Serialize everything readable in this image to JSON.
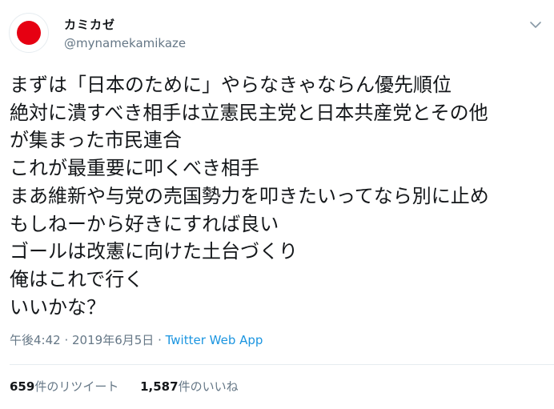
{
  "author": {
    "display_name": "カミカゼ",
    "handle": "@mynamekamikaze",
    "avatar_color": "#e60012"
  },
  "tweet": {
    "lines": [
      "まずは「日本のために」やらなきゃならん優先順位",
      "絶対に潰すべき相手は立憲民主党と日本共産党とその他",
      "が集まった市民連合",
      "これが最重要に叩くべき相手",
      "まあ維新や与党の売国勢力を叩きたいってなら別に止め",
      "もしねーから好きにすれば良い",
      "ゴールは改憲に向けた土台づくり",
      "俺はこれで行く",
      "いいかな？"
    ],
    "time": "午後4:42",
    "separator": "·",
    "date": "2019年6月5日",
    "source": "Twitter Web App"
  },
  "stats": {
    "retweets_count": "659",
    "retweets_label": "件のリツイート",
    "likes_count": "1,587",
    "likes_label": "件のいいね"
  },
  "icons": {
    "menu": "chevron-down-icon"
  }
}
